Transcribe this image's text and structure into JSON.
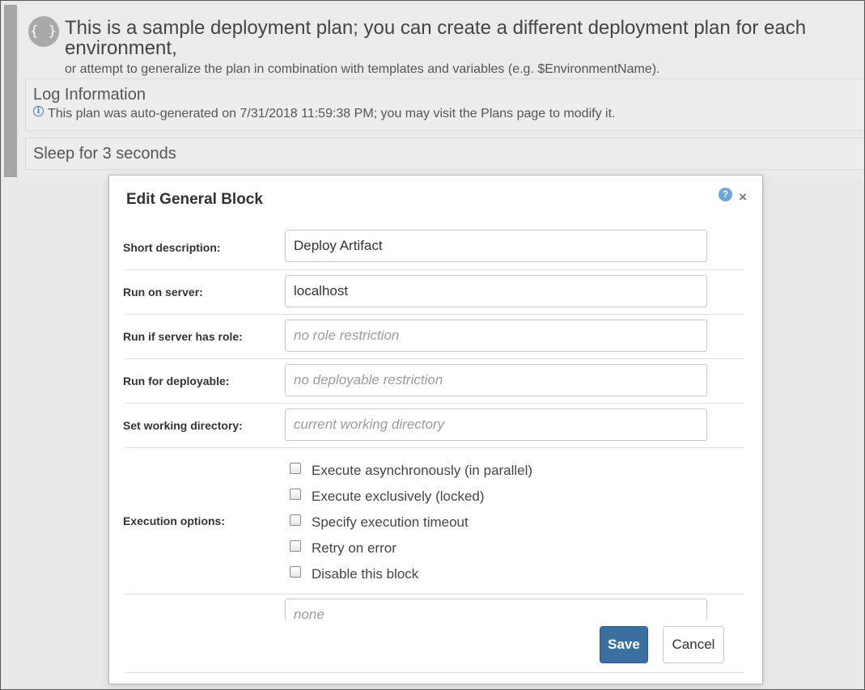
{
  "plan": {
    "icon": "{ }",
    "title": "This is a sample deployment plan; you can create a different deployment plan for each environment,",
    "subtitle": "or attempt to generalize the plan in combination with templates and variables (e.g. $EnvironmentName).",
    "log": {
      "title": "Log Information",
      "info": "This plan was auto-generated on 7/31/2018 11:59:38 PM; you may visit the Plans page to modify it."
    },
    "sleep_title": "Sleep for 3 seconds"
  },
  "dialog": {
    "title": "Edit General Block",
    "help_icon": "?",
    "close_icon": "×",
    "fields": {
      "short_description": {
        "label": "Short description:",
        "value": "Deploy Artifact",
        "placeholder": ""
      },
      "run_on_server": {
        "label": "Run on server:",
        "value": "localhost",
        "placeholder": ""
      },
      "server_role": {
        "label": "Run if server has role:",
        "value": "",
        "placeholder": "no role restriction"
      },
      "deployable": {
        "label": "Run for deployable:",
        "value": "",
        "placeholder": "no deployable restriction"
      },
      "working_directory": {
        "label": "Set working directory:",
        "value": "",
        "placeholder": "current working directory"
      },
      "extra": {
        "value": "",
        "placeholder": "none"
      }
    },
    "execution_options": {
      "label": "Execution options:",
      "items": [
        {
          "label": "Execute asynchronously (in parallel)",
          "checked": false
        },
        {
          "label": "Execute exclusively (locked)",
          "checked": false
        },
        {
          "label": "Specify execution timeout",
          "checked": false
        },
        {
          "label": "Retry on error",
          "checked": false
        },
        {
          "label": "Disable this block",
          "checked": false
        }
      ]
    },
    "buttons": {
      "save": "Save",
      "cancel": "Cancel"
    }
  },
  "colors": {
    "primary_button": "#3b6fa0",
    "help_icon": "#6aa5db",
    "plan_accent_bar": "#a5a5a5"
  }
}
